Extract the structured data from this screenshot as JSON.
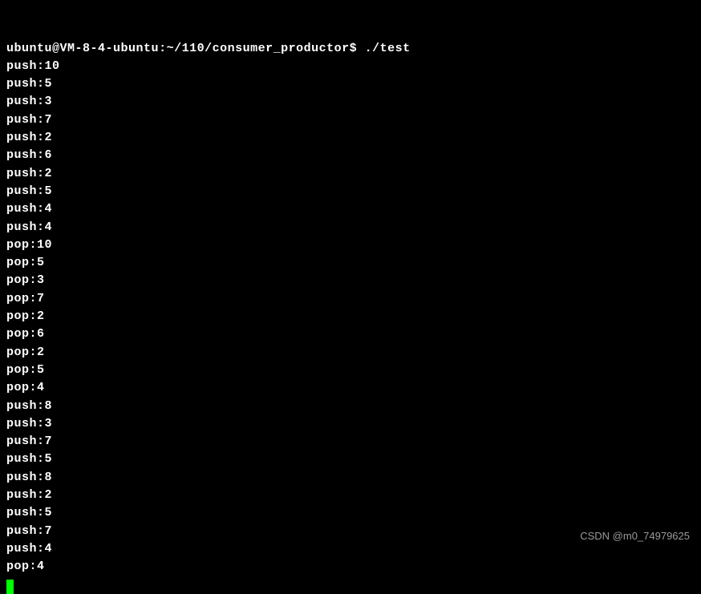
{
  "prompt": {
    "user": "ubuntu",
    "host": "VM-8-4-ubuntu",
    "path": "~/110/consumer_productor",
    "symbol": "$",
    "command": "./test"
  },
  "output_lines": [
    "push:10",
    "push:5",
    "push:3",
    "push:7",
    "push:2",
    "push:6",
    "push:2",
    "push:5",
    "push:4",
    "push:4",
    "pop:10",
    "pop:5",
    "pop:3",
    "pop:7",
    "pop:2",
    "pop:6",
    "pop:2",
    "pop:5",
    "pop:4",
    "push:8",
    "push:3",
    "push:7",
    "push:5",
    "push:8",
    "push:2",
    "push:5",
    "push:7",
    "push:4",
    "pop:4"
  ],
  "watermark": "CSDN @m0_74979625"
}
